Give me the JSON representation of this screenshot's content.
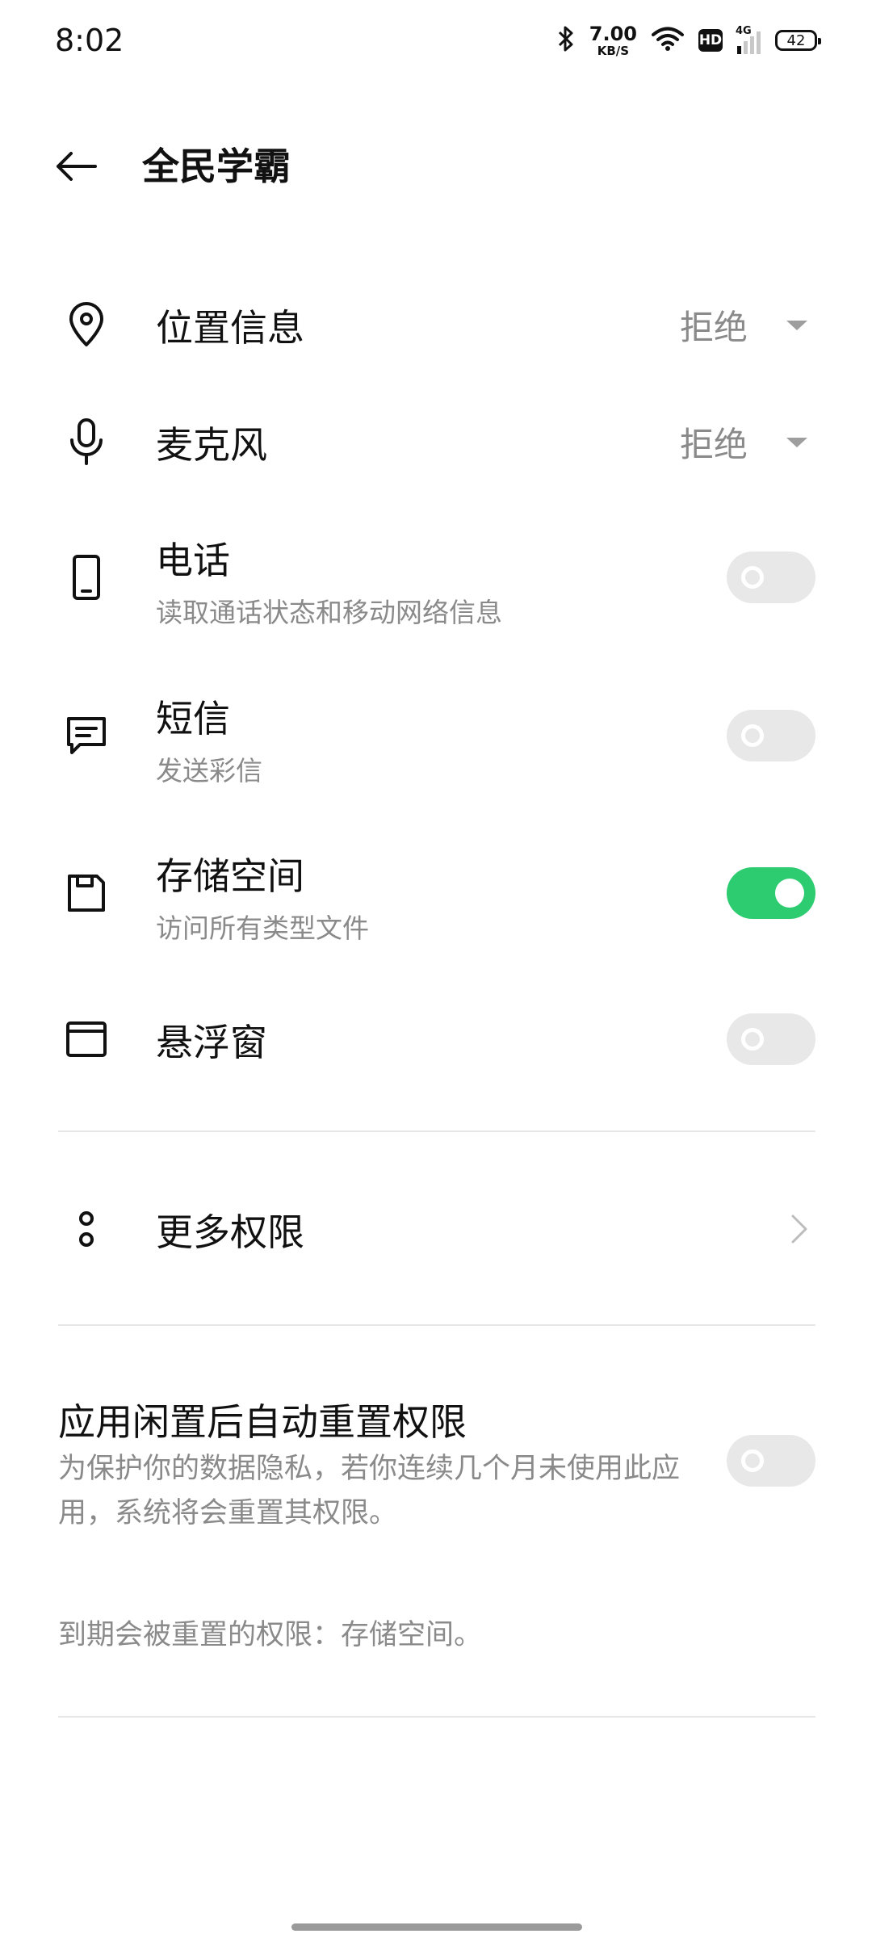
{
  "status_bar": {
    "time": "8:02",
    "net_speed_value": "7.00",
    "net_speed_unit": "KB/S",
    "hd_label": "HD",
    "network_label": "4G",
    "battery_level": "42",
    "icons": [
      "bluetooth-icon",
      "wifi-icon",
      "hd-icon",
      "cellular-signal-icon",
      "battery-icon"
    ]
  },
  "header": {
    "title": "全民学霸",
    "back_icon": "arrow-left-icon"
  },
  "permissions": [
    {
      "icon": "location-pin-icon",
      "title": "位置信息",
      "control": "dropdown",
      "value": "拒绝"
    },
    {
      "icon": "microphone-icon",
      "title": "麦克风",
      "control": "dropdown",
      "value": "拒绝"
    },
    {
      "icon": "phone-icon",
      "title": "电话",
      "subtitle": "读取通话状态和移动网络信息",
      "control": "toggle",
      "enabled": false
    },
    {
      "icon": "message-icon",
      "title": "短信",
      "subtitle": "发送彩信",
      "control": "toggle",
      "enabled": false
    },
    {
      "icon": "storage-icon",
      "title": "存储空间",
      "subtitle": "访问所有类型文件",
      "control": "toggle",
      "enabled": true
    },
    {
      "icon": "floating-window-icon",
      "title": "悬浮窗",
      "control": "toggle",
      "enabled": false
    }
  ],
  "more_permissions": {
    "icon": "more-dots-icon",
    "label": "更多权限"
  },
  "auto_reset": {
    "title": "应用闲置后自动重置权限",
    "description": "为保护你的数据隐私，若你连续几个月未使用此应用，系统将会重置其权限。",
    "enabled": false,
    "note": "到期会被重置的权限：存储空间。"
  },
  "colors": {
    "toggle_on": "#2ecc71",
    "toggle_off": "#e8e8e8",
    "secondary_text": "#8a8a8a"
  }
}
